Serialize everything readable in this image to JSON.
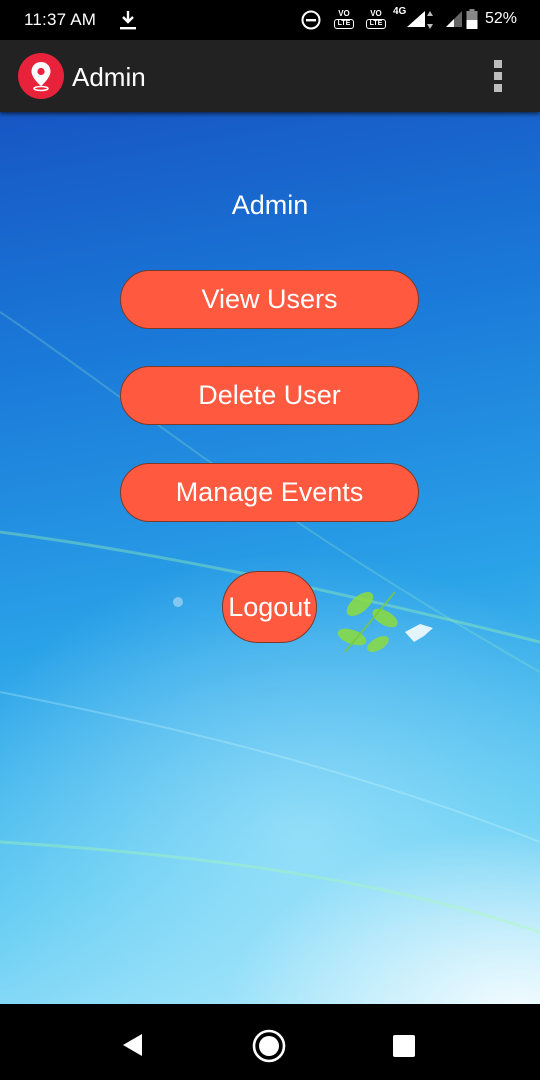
{
  "status_bar": {
    "time": "11:37 AM",
    "network": "4G",
    "volte_1": "VO",
    "volte_2": "VO",
    "lte": "LTE",
    "battery": "52%",
    "icons": [
      "download-icon",
      "do-not-disturb-icon",
      "volte-icon",
      "signal-icon",
      "battery-icon"
    ]
  },
  "app_bar": {
    "title": "Admin",
    "logo_icon": "location-pin-icon",
    "menu_icon": "overflow-menu-icon",
    "color": "#222222",
    "logo_color": "#e8223a"
  },
  "main": {
    "heading": "Admin",
    "buttons": {
      "view_users": "View Users",
      "delete_user": "Delete User",
      "manage_events": "Manage Events",
      "logout": "Logout"
    },
    "button_color": "#ff5a40"
  },
  "nav_bar": {
    "icons": [
      "back-icon",
      "home-icon",
      "recents-icon"
    ]
  }
}
